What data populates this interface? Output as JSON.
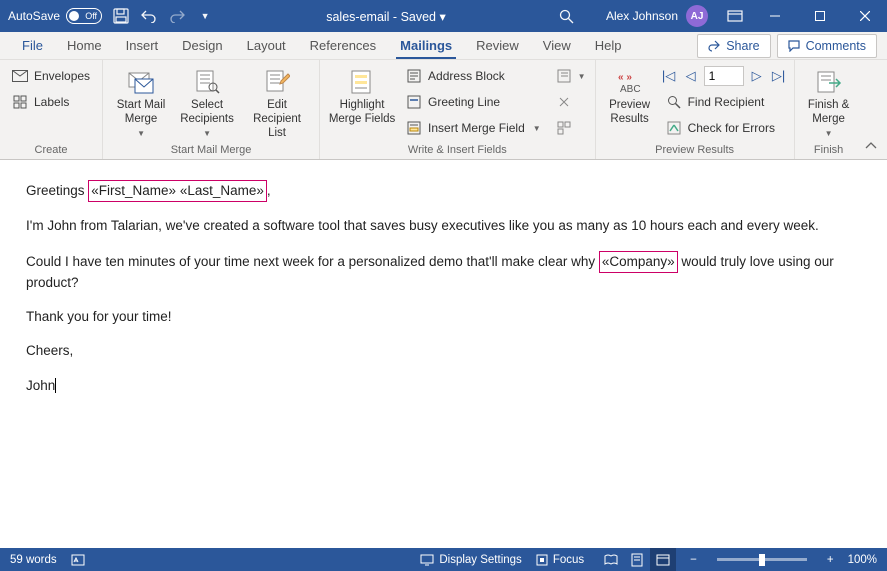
{
  "titlebar": {
    "autosave_label": "AutoSave",
    "autosave_state": "Off",
    "doc_name": "sales-email",
    "save_state": "Saved",
    "user_name": "Alex Johnson",
    "user_initials": "AJ"
  },
  "tabs": {
    "file": "File",
    "home": "Home",
    "insert": "Insert",
    "design": "Design",
    "layout": "Layout",
    "references": "References",
    "mailings": "Mailings",
    "review": "Review",
    "view": "View",
    "help": "Help",
    "share": "Share",
    "comments": "Comments"
  },
  "ribbon": {
    "create": {
      "label": "Create",
      "envelopes": "Envelopes",
      "labels": "Labels"
    },
    "start": {
      "label": "Start Mail Merge",
      "start_merge": "Start Mail\nMerge",
      "select_recipients": "Select\nRecipients",
      "edit_list": "Edit\nRecipient List"
    },
    "write": {
      "label": "Write & Insert Fields",
      "highlight": "Highlight\nMerge Fields",
      "address_block": "Address Block",
      "greeting_line": "Greeting Line",
      "insert_field": "Insert Merge Field"
    },
    "preview": {
      "label": "Preview Results",
      "preview_results": "Preview\nResults",
      "record_number": "1",
      "find_recipient": "Find Recipient",
      "check_errors": "Check for Errors"
    },
    "finish": {
      "label": "Finish",
      "finish_merge": "Finish &\nMerge"
    }
  },
  "document": {
    "greeting_pre": "Greetings ",
    "field_first": "«First_Name»",
    "field_last": "«Last_Name»",
    "greeting_post": ",",
    "p2": "I'm John from Talarian, we've created a software tool that saves busy executives like you as many as 10 hours each and every week.",
    "p3a": "Could I have ten minutes of your time next week for a personalized demo that'll make clear why ",
    "field_company": "«Company»",
    "p3b": " would truly love using our product?",
    "p4": "Thank you for your time!",
    "p5": "Cheers,",
    "p6": "John"
  },
  "statusbar": {
    "words": "59 words",
    "display_settings": "Display Settings",
    "focus": "Focus",
    "zoom": "100%"
  }
}
